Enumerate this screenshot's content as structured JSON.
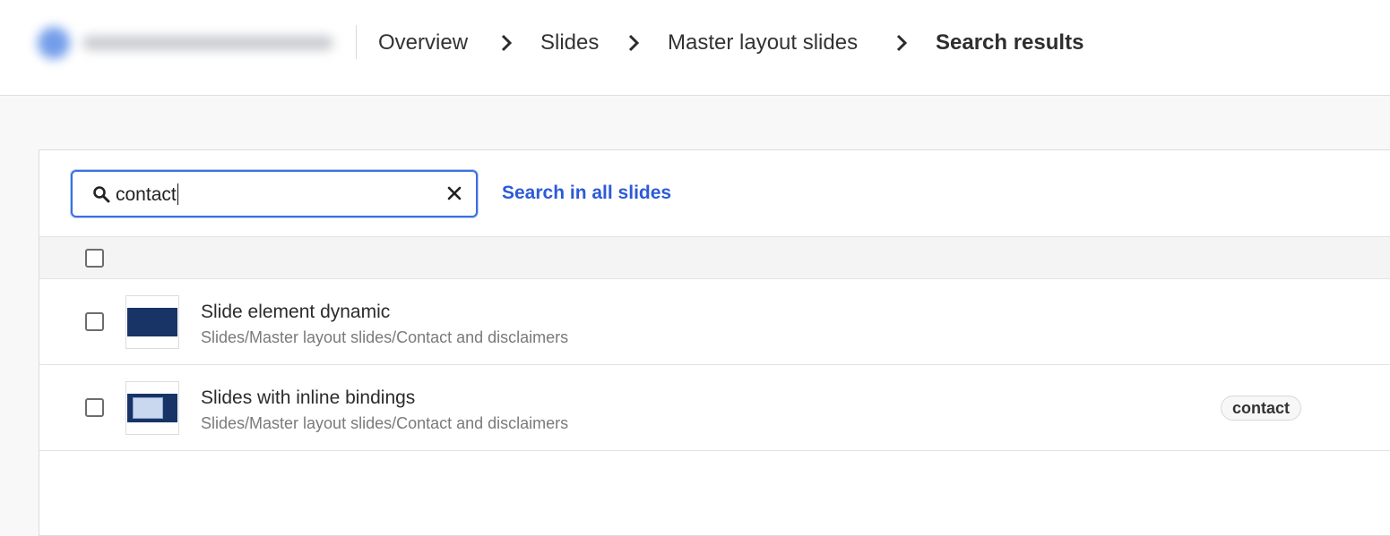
{
  "breadcrumb": {
    "items": [
      "Overview",
      "Slides",
      "Master layout slides"
    ],
    "current": "Search results"
  },
  "icons": {
    "separator": "chevron-right-icon",
    "search": "search-icon",
    "clear": "close-icon"
  },
  "search": {
    "value": "contact",
    "scope_link": "Search in all slides"
  },
  "results": [
    {
      "title": "Slide element dynamic",
      "path": "Slides/Master layout slides/Contact and disclaimers",
      "tags": [],
      "checked": false
    },
    {
      "title": "Slides with inline bindings",
      "path": "Slides/Master layout slides/Contact and disclaimers",
      "tags": [
        "contact"
      ],
      "checked": false
    }
  ],
  "colors": {
    "accent": "#2c5ad8",
    "focus_border": "#3b6fe0",
    "thumbnail_band": "#183466"
  }
}
